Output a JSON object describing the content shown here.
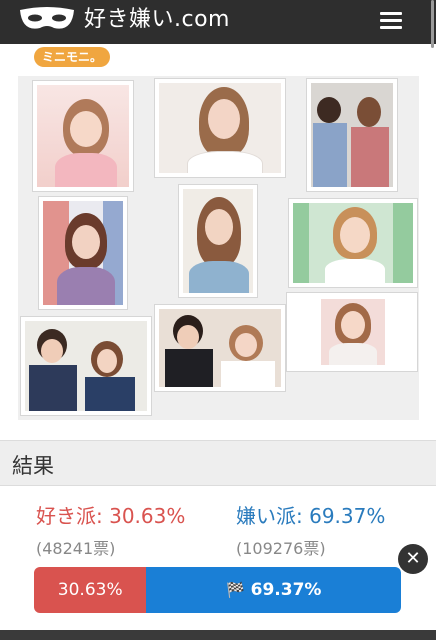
{
  "header": {
    "title": "好き嫌い.com",
    "logo_icon": "mask-icon",
    "menu_icon": "hamburger-menu-icon"
  },
  "tag": {
    "label": "ミニモニ。"
  },
  "gallery": {
    "photos": [
      {
        "name": "photo-1"
      },
      {
        "name": "photo-2"
      },
      {
        "name": "photo-3"
      },
      {
        "name": "photo-4"
      },
      {
        "name": "photo-5"
      },
      {
        "name": "photo-6"
      },
      {
        "name": "photo-7"
      },
      {
        "name": "photo-8"
      },
      {
        "name": "photo-9"
      }
    ]
  },
  "result": {
    "heading": "結果",
    "like_label": "好き派: 30.63%",
    "dislike_label": "嫌い派: 69.37%",
    "like_votes": "(48241票)",
    "dislike_votes": "(109276票)",
    "like_percent_text": "30.63%",
    "dislike_percent_text": "69.37%",
    "like_fraction": 0.3063,
    "flag_icon": "checkered-flag-icon",
    "close_icon": "close-icon"
  },
  "colors": {
    "header_bg": "#2e2e2e",
    "tag_bg": "#f0a640",
    "like": "#d9534f",
    "dislike": "#1a7fd6"
  }
}
